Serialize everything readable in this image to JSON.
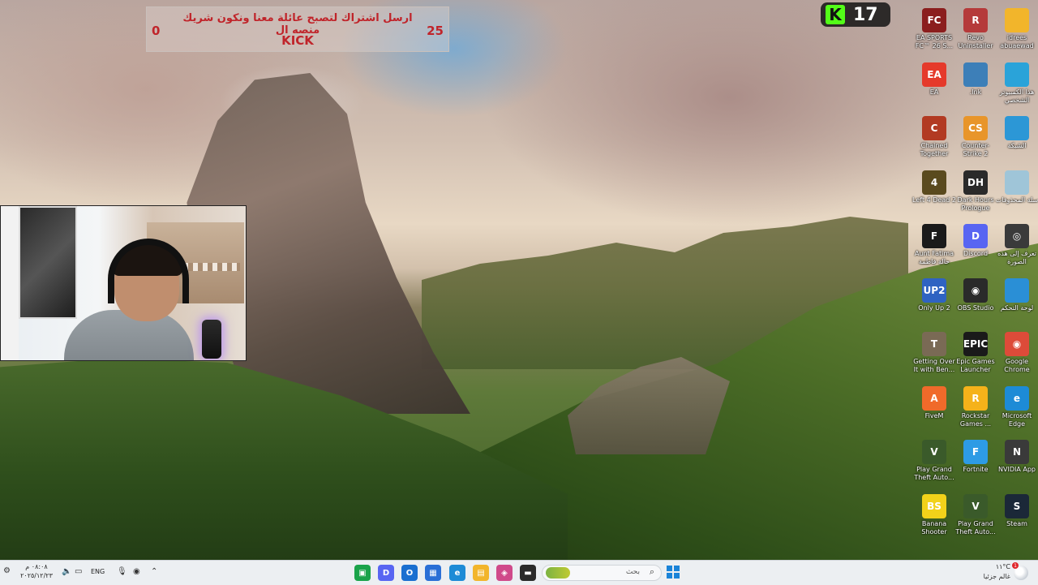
{
  "overlay": {
    "left_count": "0",
    "right_count": "25",
    "line1": "ارسل اشتراك لتصبح عائلة معنا ونكون شريك منصه ال",
    "line2": "KICK"
  },
  "kick_viewers": {
    "logo": "K",
    "count": "17"
  },
  "desktop_icons": [
    {
      "label": "EA SPORTS FC™ 26 S...",
      "icon": "ea-sports-fc-icon",
      "color": "#8b1e1e",
      "glyph": "FC"
    },
    {
      "label": "Revo Uninstaller",
      "icon": "revo-uninstaller-icon",
      "color": "#b53a3a",
      "glyph": "R"
    },
    {
      "label": "idrees abuaewad",
      "icon": "folder-icon",
      "color": "#f2b52b",
      "glyph": ""
    },
    {
      "label": "EA",
      "icon": "ea-app-icon",
      "color": "#e53a2b",
      "glyph": "EA"
    },
    {
      "label": ".lnk",
      "icon": "game-shortcut-icon",
      "color": "#3d7fb8",
      "glyph": ""
    },
    {
      "label": "هذا الكمبيوتر الشخصي",
      "icon": "this-pc-icon",
      "color": "#2aa3d9",
      "glyph": ""
    },
    {
      "label": "Chained Together",
      "icon": "chained-together-icon",
      "color": "#b23a22",
      "glyph": "C"
    },
    {
      "label": "Counter-Strike 2",
      "icon": "counter-strike-icon",
      "color": "#e8952a",
      "glyph": "CS"
    },
    {
      "label": "الشبكة",
      "icon": "network-icon",
      "color": "#2c97d6",
      "glyph": ""
    },
    {
      "label": "Left 4 Dead 2",
      "icon": "left4dead-icon",
      "color": "#5a4a1e",
      "glyph": "4"
    },
    {
      "label": "Dark Hours Prologue",
      "icon": "dark-hours-icon",
      "color": "#2a2a2a",
      "glyph": "DH"
    },
    {
      "label": "سلة المحذوفات",
      "icon": "recycle-bin-icon",
      "color": "#9fc5d8",
      "glyph": ""
    },
    {
      "label": "Aunt Fatima حالة فاطمة",
      "icon": "aunt-fatima-icon",
      "color": "#1a1a1a",
      "glyph": "F"
    },
    {
      "label": "Discord",
      "icon": "discord-icon",
      "color": "#5865f2",
      "glyph": "D"
    },
    {
      "label": "تعرف إلى هذه الصورة",
      "icon": "learn-about-picture-icon",
      "color": "#3a3a3a",
      "glyph": "◎"
    },
    {
      "label": "Only Up 2",
      "icon": "only-up-icon",
      "color": "#2f63c2",
      "glyph": "UP2"
    },
    {
      "label": "OBS Studio",
      "icon": "obs-studio-icon",
      "color": "#2a2a2a",
      "glyph": "◉"
    },
    {
      "label": "لوحة التحكم",
      "icon": "control-panel-icon",
      "color": "#2a8fd6",
      "glyph": ""
    },
    {
      "label": "Getting Over It with Ben...",
      "icon": "getting-over-it-icon",
      "color": "#7a6a55",
      "glyph": "T"
    },
    {
      "label": "Epic Games Launcher",
      "icon": "epic-games-icon",
      "color": "#1a1a1a",
      "glyph": "EPIC"
    },
    {
      "label": "Google Chrome",
      "icon": "chrome-icon",
      "color": "#dd4b39",
      "glyph": "◉"
    },
    {
      "label": "FiveM",
      "icon": "fivem-icon",
      "color": "#f06a2a",
      "glyph": "A"
    },
    {
      "label": "Rockstar Games ...",
      "icon": "rockstar-icon",
      "color": "#f5b21a",
      "glyph": "R"
    },
    {
      "label": "Microsoft Edge",
      "icon": "edge-icon",
      "color": "#1d8bd6",
      "glyph": "e"
    },
    {
      "label": "Play Grand Theft Auto...",
      "icon": "gta-icon",
      "color": "#3a5a2a",
      "glyph": "V"
    },
    {
      "label": "Fortnite",
      "icon": "fortnite-icon",
      "color": "#2d9be5",
      "glyph": "F"
    },
    {
      "label": "NVIDIA App",
      "icon": "nvidia-icon",
      "color": "#3a3a3a",
      "glyph": "N"
    },
    {
      "label": "Banana Shooter",
      "icon": "banana-shooter-icon",
      "color": "#f2d21a",
      "glyph": "BS"
    },
    {
      "label": "Play Grand Theft Auto...",
      "icon": "gta-icon",
      "color": "#3a5a2a",
      "glyph": "V"
    },
    {
      "label": "Steam",
      "icon": "steam-icon",
      "color": "#1b2838",
      "glyph": "S"
    }
  ],
  "taskbar": {
    "clock_time": "٠٨:٠٨ م",
    "clock_date": "٢٠٢٥/١٢/٢٣",
    "language": "ENG",
    "search_placeholder": "بحث",
    "weather_temp": "١١°C",
    "weather_condition": "غالم جزئيا",
    "notification_count": "1",
    "pinned_apps": [
      {
        "name": "taskbar-app-1-icon",
        "color": "#1aa34a",
        "glyph": "▣"
      },
      {
        "name": "discord-taskbar-icon",
        "color": "#5865f2",
        "glyph": "D"
      },
      {
        "name": "outlook-taskbar-icon",
        "color": "#1a6fd0",
        "glyph": "O"
      },
      {
        "name": "store-taskbar-icon",
        "color": "#2a6fd6",
        "glyph": "▦"
      },
      {
        "name": "edge-taskbar-icon",
        "color": "#1d8bd6",
        "glyph": "e"
      },
      {
        "name": "file-explorer-taskbar-icon",
        "color": "#f2b52b",
        "glyph": "▤"
      },
      {
        "name": "app-taskbar-icon",
        "color": "#d04a8a",
        "glyph": "◈"
      },
      {
        "name": "terminal-taskbar-icon",
        "color": "#2a2a2a",
        "glyph": "▬"
      }
    ]
  }
}
